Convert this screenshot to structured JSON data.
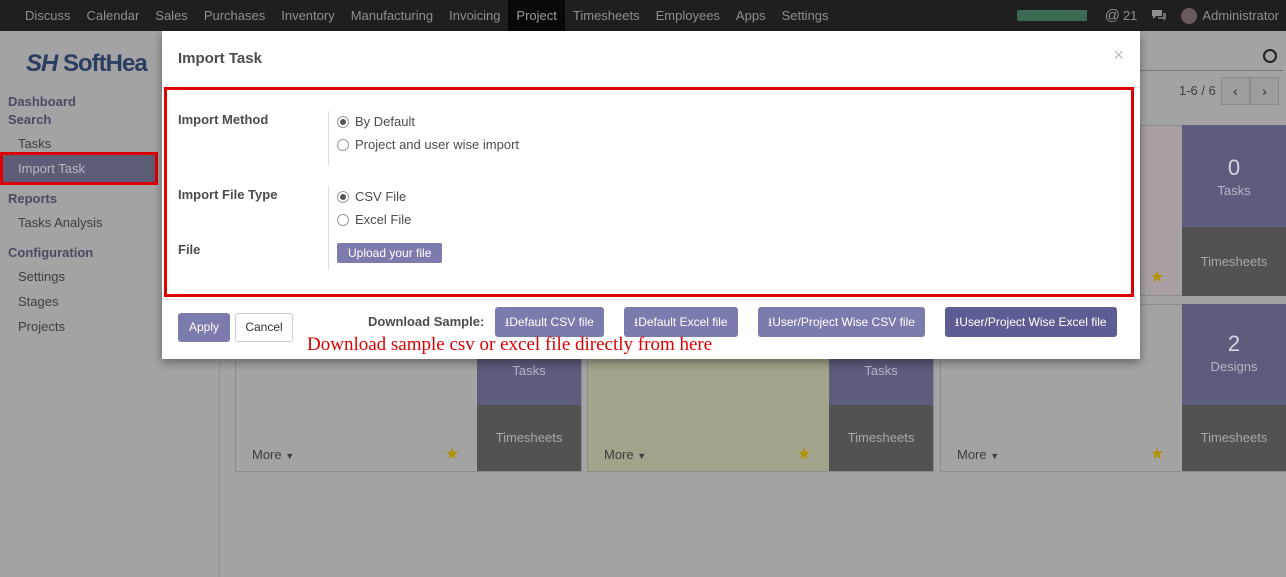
{
  "navbar": {
    "items": [
      "Discuss",
      "Calendar",
      "Sales",
      "Purchases",
      "Inventory",
      "Manufacturing",
      "Invoicing",
      "Project",
      "Timesheets",
      "Employees",
      "Apps",
      "Settings"
    ],
    "active_item": "Project",
    "progress_fraction": 1.0,
    "mention_count": "21",
    "user": "Administrator"
  },
  "sidebar": {
    "logo": "Soft",
    "logo_suffix": "Hea",
    "dashboard_section": "Dashboard",
    "search_section": "Search",
    "tasks": "Tasks",
    "import_task": "Import Task",
    "reports_section": "Reports",
    "tasks_analysis": "Tasks Analysis",
    "configuration_section": "Configuration",
    "settings": "Settings",
    "stages": "Stages",
    "projects": "Projects"
  },
  "pager": {
    "text": "1-6 / 6",
    "prev": "‹",
    "next": "›"
  },
  "cards": {
    "top_right": {
      "count": "0",
      "count_label": "Tasks",
      "timesheets": "Timesheets"
    },
    "row2_left": {
      "count_label": "Tasks",
      "timesheets": "Timesheets",
      "more": "More"
    },
    "row2_mid": {
      "count_label": "Tasks",
      "timesheets": "Timesheets",
      "more": "More"
    },
    "row2_right": {
      "count": "2",
      "count_label": "Designs",
      "timesheets": "Timesheets",
      "more": "More"
    }
  },
  "modal": {
    "title": "Import Task",
    "close": "×",
    "import_method": {
      "label": "Import Method",
      "options": [
        "By Default",
        "Project and user wise import"
      ],
      "selected_index": 0
    },
    "import_file_type": {
      "label": "Import File Type",
      "options": [
        "CSV File",
        "Excel File"
      ],
      "selected_index": 0
    },
    "file": {
      "label": "File",
      "upload_label": "Upload your file"
    },
    "footer": {
      "apply": "Apply",
      "cancel": "Cancel",
      "download_label": "Download Sample:",
      "default_csv": "Default CSV file",
      "default_excel": "Default Excel file",
      "user_project_csv": "User/Project Wise CSV file",
      "user_project_excel": "User/Project Wise Excel file"
    }
  },
  "annotation": "Download sample csv or excel file directly from here",
  "colors": {
    "primary": "#7c7bad",
    "highlight": "#dd0000",
    "navbar": "#1f1f1f"
  }
}
